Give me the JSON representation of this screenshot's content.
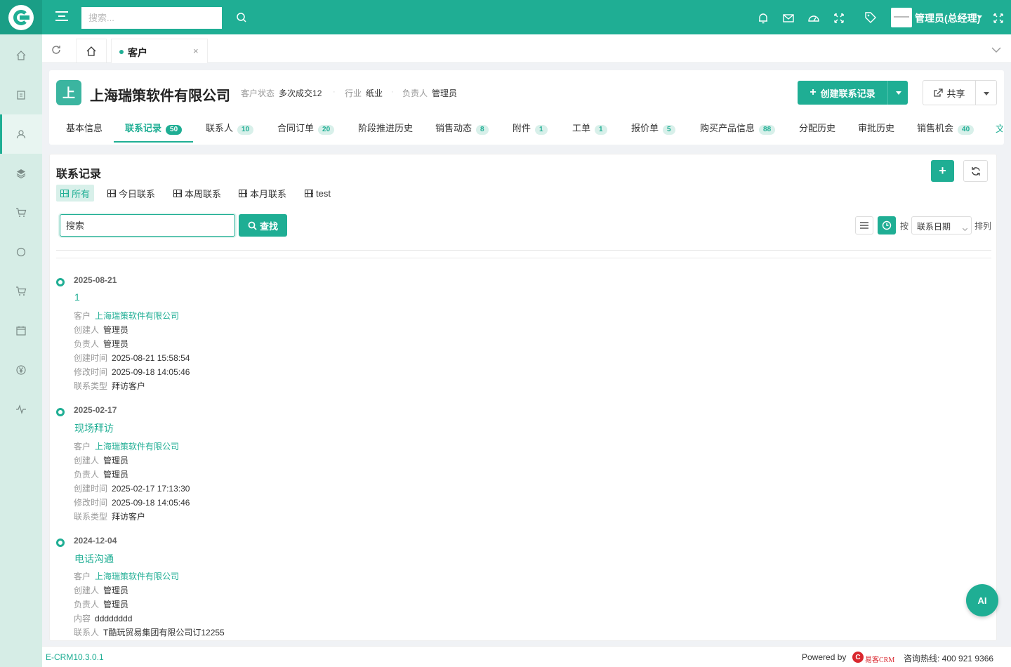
{
  "topbar": {
    "search_placeholder": "搜索...",
    "user_name": "管理员(总经理)"
  },
  "sidebar": {
    "items": [
      {
        "icon": "home-icon"
      },
      {
        "icon": "clipboard-icon"
      },
      {
        "icon": "user-icon",
        "active": true
      },
      {
        "icon": "layers-icon"
      },
      {
        "icon": "cart-icon"
      },
      {
        "icon": "circle-icon"
      },
      {
        "icon": "cart-alt-icon"
      },
      {
        "icon": "calendar-icon"
      },
      {
        "icon": "yen-icon"
      },
      {
        "icon": "activity-icon"
      }
    ]
  },
  "tabbar": {
    "tabs": [
      {
        "label": "客户",
        "closable": true
      }
    ],
    "close_glyph": "×"
  },
  "customer": {
    "avatar_letter": "上",
    "name": "上海瑞策软件有限公司",
    "status_label": "客户状态",
    "status_value": "多次成交12",
    "industry_label": "行业",
    "industry_value": "纸业",
    "owner_label": "负责人",
    "owner_value": "管理员",
    "separator": "·",
    "create_button": "创建联系记录",
    "share_button": "共享"
  },
  "detail_tabs": [
    {
      "label": "基本信息",
      "count": null,
      "active": false
    },
    {
      "label": "联系记录",
      "count": "50",
      "active": true
    },
    {
      "label": "联系人",
      "count": "10",
      "active": false
    },
    {
      "label": "合同订单",
      "count": "20",
      "active": false
    },
    {
      "label": "阶段推进历史",
      "count": null,
      "active": false
    },
    {
      "label": "销售动态",
      "count": "8",
      "active": false
    },
    {
      "label": "附件",
      "count": "1",
      "active": false
    },
    {
      "label": "工单",
      "count": "1",
      "active": false
    },
    {
      "label": "报价单",
      "count": "5",
      "active": false
    },
    {
      "label": "购买产品信息",
      "count": "88",
      "active": false
    },
    {
      "label": "分配历史",
      "count": null,
      "active": false
    },
    {
      "label": "审批历史",
      "count": null,
      "active": false
    },
    {
      "label": "销售机会",
      "count": "40",
      "active": false
    }
  ],
  "detail_tabs_more": "文",
  "panel": {
    "title": "联系记录",
    "add_glyph": "+",
    "view_tabs": [
      {
        "label": "所有",
        "active": true
      },
      {
        "label": "今日联系",
        "active": false
      },
      {
        "label": "本周联系",
        "active": false
      },
      {
        "label": "本月联系",
        "active": false
      },
      {
        "label": "test",
        "active": false
      }
    ],
    "search_placeholder": "搜索",
    "search_button": "查找",
    "sort_by": "按",
    "sort_field": "联系日期",
    "sort_label": "排列"
  },
  "timeline": [
    {
      "date": "2025-08-21",
      "title": "1",
      "fields": [
        {
          "k": "客户",
          "v": "上海瑞策软件有限公司",
          "link": true
        },
        {
          "k": "创建人",
          "v": "管理员"
        },
        {
          "k": "负责人",
          "v": "管理员"
        },
        {
          "k": "创建时间",
          "v": "2025-08-21 15:58:54"
        },
        {
          "k": "修改时间",
          "v": "2025-09-18 14:05:46"
        },
        {
          "k": "联系类型",
          "v": "拜访客户"
        }
      ]
    },
    {
      "date": "2025-02-17",
      "title": "现场拜访",
      "fields": [
        {
          "k": "客户",
          "v": "上海瑞策软件有限公司",
          "link": true
        },
        {
          "k": "创建人",
          "v": "管理员"
        },
        {
          "k": "负责人",
          "v": "管理员"
        },
        {
          "k": "创建时间",
          "v": "2025-02-17 17:13:30"
        },
        {
          "k": "修改时间",
          "v": "2025-09-18 14:05:46"
        },
        {
          "k": "联系类型",
          "v": "拜访客户"
        }
      ]
    },
    {
      "date": "2024-12-04",
      "title": "电话沟通",
      "fields": [
        {
          "k": "客户",
          "v": "上海瑞策软件有限公司",
          "link": true
        },
        {
          "k": "创建人",
          "v": "管理员"
        },
        {
          "k": "负责人",
          "v": "管理员"
        },
        {
          "k": "内容",
          "v": "dddddddd"
        },
        {
          "k": "联系人",
          "v": "T酷玩贸易集团有限公司订12255"
        }
      ]
    }
  ],
  "ai_button": "AI",
  "footer": {
    "version": "E-CRM10.3.0.1",
    "powered": "Powered by",
    "brand_letter": "C",
    "brand_text": "易客CRM",
    "hotline": "咨询热线: 400 921 9366"
  },
  "colors": {
    "brand": "#1fae94",
    "sidebar_bg": "#d6ede6",
    "brand_red": "#d9272e"
  }
}
